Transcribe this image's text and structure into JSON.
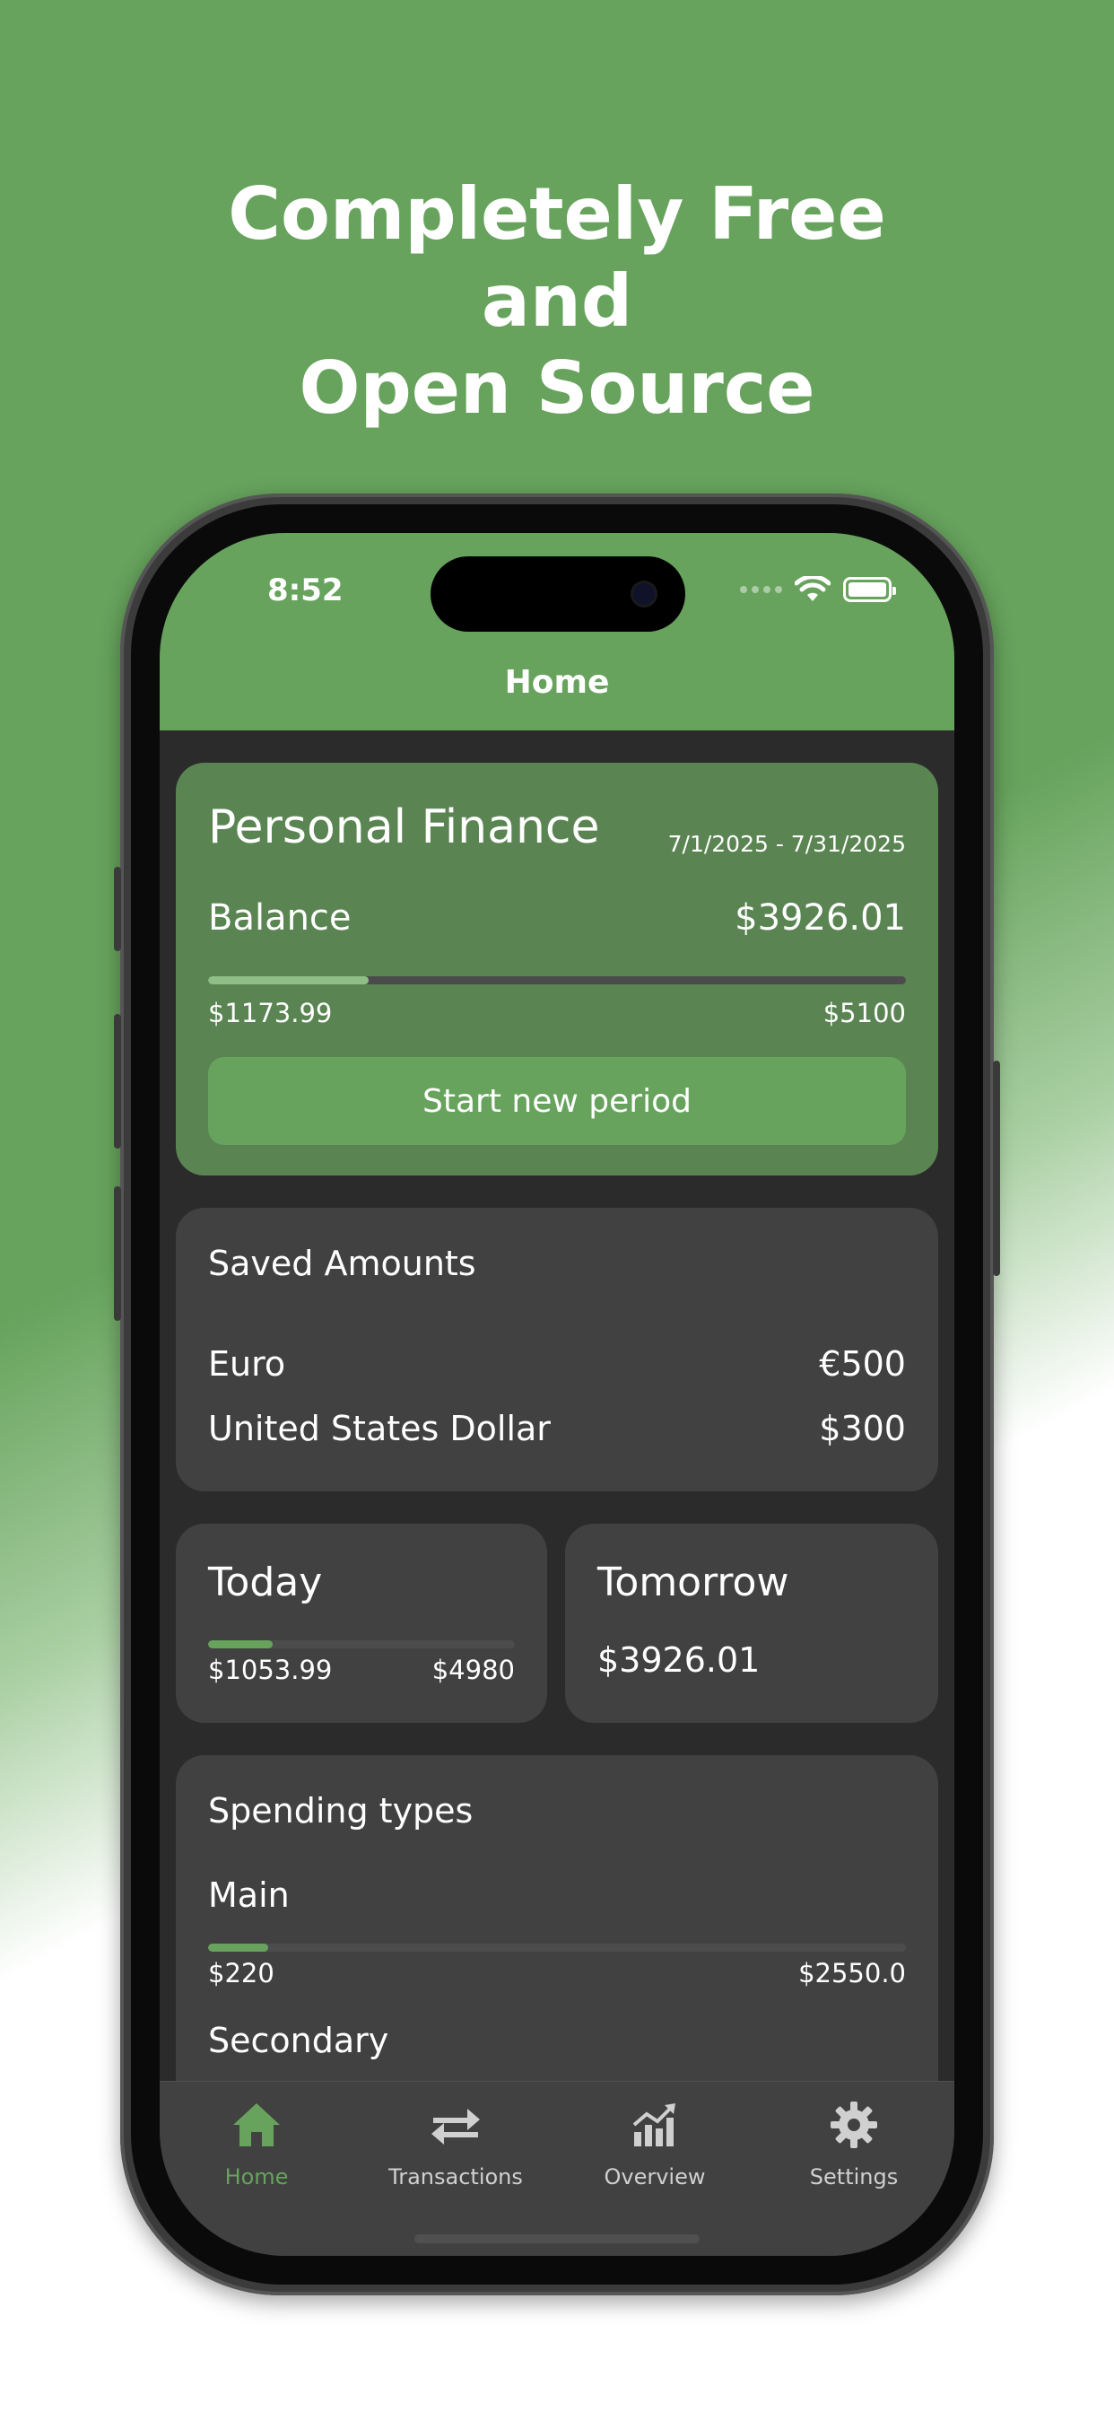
{
  "headline": {
    "line1": "Completely Free",
    "line2": "and",
    "line3": "Open Source"
  },
  "status_bar": {
    "time": "8:52",
    "icons": [
      "signal-dots-icon",
      "wifi-icon",
      "battery-icon"
    ]
  },
  "nav": {
    "title": "Home"
  },
  "finance_card": {
    "title": "Personal Finance",
    "date_range": "7/1/2025 - 7/31/2025",
    "balance_label": "Balance",
    "balance_value": "$3926.01",
    "spent": "$1173.99",
    "budget": "$5100",
    "progress": 0.23,
    "button_label": "Start new period"
  },
  "saved_amounts": {
    "title": "Saved Amounts",
    "items": [
      {
        "currency": "Euro",
        "amount": "€500"
      },
      {
        "currency": "United States Dollar",
        "amount": "$300"
      }
    ]
  },
  "today": {
    "title": "Today",
    "spent": "$1053.99",
    "limit": "$4980",
    "progress": 0.21
  },
  "tomorrow": {
    "title": "Tomorrow",
    "value": "$3926.01"
  },
  "spending_types": {
    "title": "Spending types",
    "items": [
      {
        "name": "Main",
        "spent": "$220",
        "limit": "$2550.0",
        "progress": 0.086
      },
      {
        "name": "Secondary"
      }
    ]
  },
  "tabs": [
    {
      "label": "Home",
      "icon": "home-icon",
      "active": true
    },
    {
      "label": "Transactions",
      "icon": "arrows-icon",
      "active": false
    },
    {
      "label": "Overview",
      "icon": "chart-icon",
      "active": false
    },
    {
      "label": "Settings",
      "icon": "gear-icon",
      "active": false
    }
  ],
  "colors": {
    "accent": "#67a35d",
    "card": "#414141",
    "card_accent": "#5a8552",
    "screen_bg": "#2b2b2b"
  }
}
